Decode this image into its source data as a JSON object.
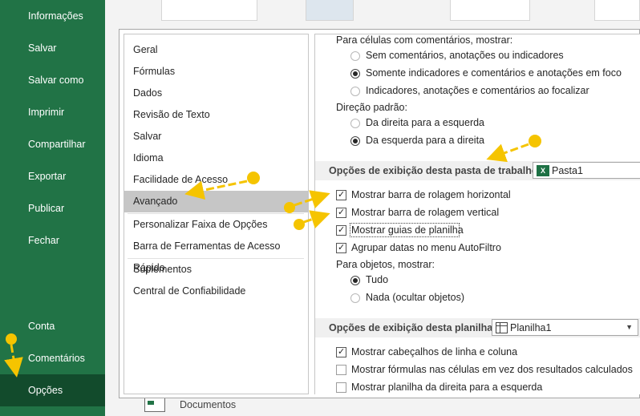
{
  "backstage": {
    "items": [
      {
        "label": "Informações"
      },
      {
        "label": "Salvar"
      },
      {
        "label": "Salvar como"
      },
      {
        "label": "Imprimir"
      },
      {
        "label": "Compartilhar"
      },
      {
        "label": "Exportar"
      },
      {
        "label": "Publicar"
      },
      {
        "label": "Fechar"
      }
    ],
    "bottom_items": [
      {
        "label": "Conta"
      },
      {
        "label": "Comentários"
      },
      {
        "label": "Opções"
      }
    ],
    "background_label": "Documentos",
    "accent_color": "#217346"
  },
  "nav": {
    "items": [
      {
        "label": "Geral"
      },
      {
        "label": "Fórmulas"
      },
      {
        "label": "Dados"
      },
      {
        "label": "Revisão de Texto"
      },
      {
        "label": "Salvar"
      },
      {
        "label": "Idioma"
      },
      {
        "label": "Facilidade de Acesso"
      },
      {
        "label": "Avançado"
      },
      {
        "label": "Personalizar Faixa de Opções"
      },
      {
        "label": "Barra de Ferramentas de Acesso Rápido"
      },
      {
        "label": "Suplementos"
      },
      {
        "label": "Central de Confiabilidade"
      }
    ],
    "selected": "Avançado"
  },
  "content": {
    "comments": {
      "heading": "Para células com comentários, mostrar:",
      "options": [
        {
          "label": "Sem comentários, anotações ou indicadores",
          "checked": false
        },
        {
          "label": "Somente indicadores e comentários e anotações em foco",
          "checked": true
        },
        {
          "label": "Indicadores, anotações e comentários ao focalizar",
          "checked": false
        }
      ]
    },
    "direction": {
      "heading": "Direção padrão:",
      "options": [
        {
          "label": "Da direita para a esquerda",
          "checked": false
        },
        {
          "label": "Da esquerda para a direita",
          "checked": true
        }
      ]
    },
    "workbook_section": {
      "title": "Opções de exibição desta pasta de trabalho:",
      "selected_workbook": "Pasta1",
      "checks": [
        {
          "label": "Mostrar barra de rolagem horizontal",
          "checked": true
        },
        {
          "label": "Mostrar barra de rolagem vertical",
          "checked": true
        },
        {
          "label": "Mostrar guias de planilha",
          "checked": true
        },
        {
          "label": "Agrupar datas no menu AutoFiltro",
          "checked": true
        }
      ],
      "objects_heading": "Para objetos, mostrar:",
      "objects_options": [
        {
          "label": "Tudo",
          "checked": true
        },
        {
          "label": "Nada (ocultar objetos)",
          "checked": false
        }
      ]
    },
    "sheet_section": {
      "title": "Opções de exibição desta planilha:",
      "selected_sheet": "Planilha1",
      "checks": [
        {
          "label": "Mostrar cabeçalhos de linha e coluna",
          "checked": true
        },
        {
          "label": "Mostrar fórmulas nas células em vez dos resultados calculados",
          "checked": false
        },
        {
          "label": "Mostrar planilha da direita para a esquerda",
          "checked": false
        }
      ]
    }
  },
  "annotation_color": "#f5c400"
}
